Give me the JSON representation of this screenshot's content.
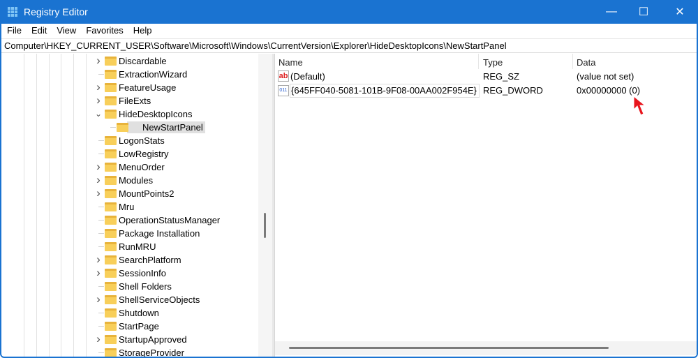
{
  "window": {
    "title": "Registry Editor",
    "minimize": "—",
    "maximize": "☐",
    "close": "✕"
  },
  "menu": [
    "File",
    "Edit",
    "View",
    "Favorites",
    "Help"
  ],
  "address": "Computer\\HKEY_CURRENT_USER\\Software\\Microsoft\\Windows\\CurrentVersion\\Explorer\\HideDesktopIcons\\NewStartPanel",
  "tree": [
    {
      "label": "Discardable",
      "chevron": "›",
      "indent": 0
    },
    {
      "label": "ExtractionWizard",
      "chevron": "",
      "indent": 0
    },
    {
      "label": "FeatureUsage",
      "chevron": "›",
      "indent": 0
    },
    {
      "label": "FileExts",
      "chevron": "›",
      "indent": 0
    },
    {
      "label": "HideDesktopIcons",
      "chevron": "⌄",
      "indent": 0
    },
    {
      "label": "NewStartPanel",
      "chevron": "",
      "indent": 1,
      "selected": true
    },
    {
      "label": "LogonStats",
      "chevron": "",
      "indent": 0
    },
    {
      "label": "LowRegistry",
      "chevron": "",
      "indent": 0
    },
    {
      "label": "MenuOrder",
      "chevron": "›",
      "indent": 0
    },
    {
      "label": "Modules",
      "chevron": "›",
      "indent": 0
    },
    {
      "label": "MountPoints2",
      "chevron": "›",
      "indent": 0
    },
    {
      "label": "Mru",
      "chevron": "",
      "indent": 0
    },
    {
      "label": "OperationStatusManager",
      "chevron": "",
      "indent": 0
    },
    {
      "label": "Package Installation",
      "chevron": "",
      "indent": 0
    },
    {
      "label": "RunMRU",
      "chevron": "",
      "indent": 0
    },
    {
      "label": "SearchPlatform",
      "chevron": "›",
      "indent": 0
    },
    {
      "label": "SessionInfo",
      "chevron": "›",
      "indent": 0
    },
    {
      "label": "Shell Folders",
      "chevron": "",
      "indent": 0
    },
    {
      "label": "ShellServiceObjects",
      "chevron": "›",
      "indent": 0
    },
    {
      "label": "Shutdown",
      "chevron": "",
      "indent": 0
    },
    {
      "label": "StartPage",
      "chevron": "",
      "indent": 0
    },
    {
      "label": "StartupApproved",
      "chevron": "›",
      "indent": 0
    },
    {
      "label": "StorageProvider",
      "chevron": "",
      "indent": 0
    }
  ],
  "columns": {
    "name": "Name",
    "type": "Type",
    "data": "Data"
  },
  "values": [
    {
      "icon": "ab",
      "name": "(Default)",
      "type": "REG_SZ",
      "data": "(value not set)"
    },
    {
      "icon": "011",
      "name": "{645FF040-5081-101B-9F08-00AA002F954E}",
      "type": "REG_DWORD",
      "data": "0x00000000 (0)"
    }
  ],
  "colors": {
    "titlebar": "#1a73d1",
    "cursor": "#e8141c"
  }
}
